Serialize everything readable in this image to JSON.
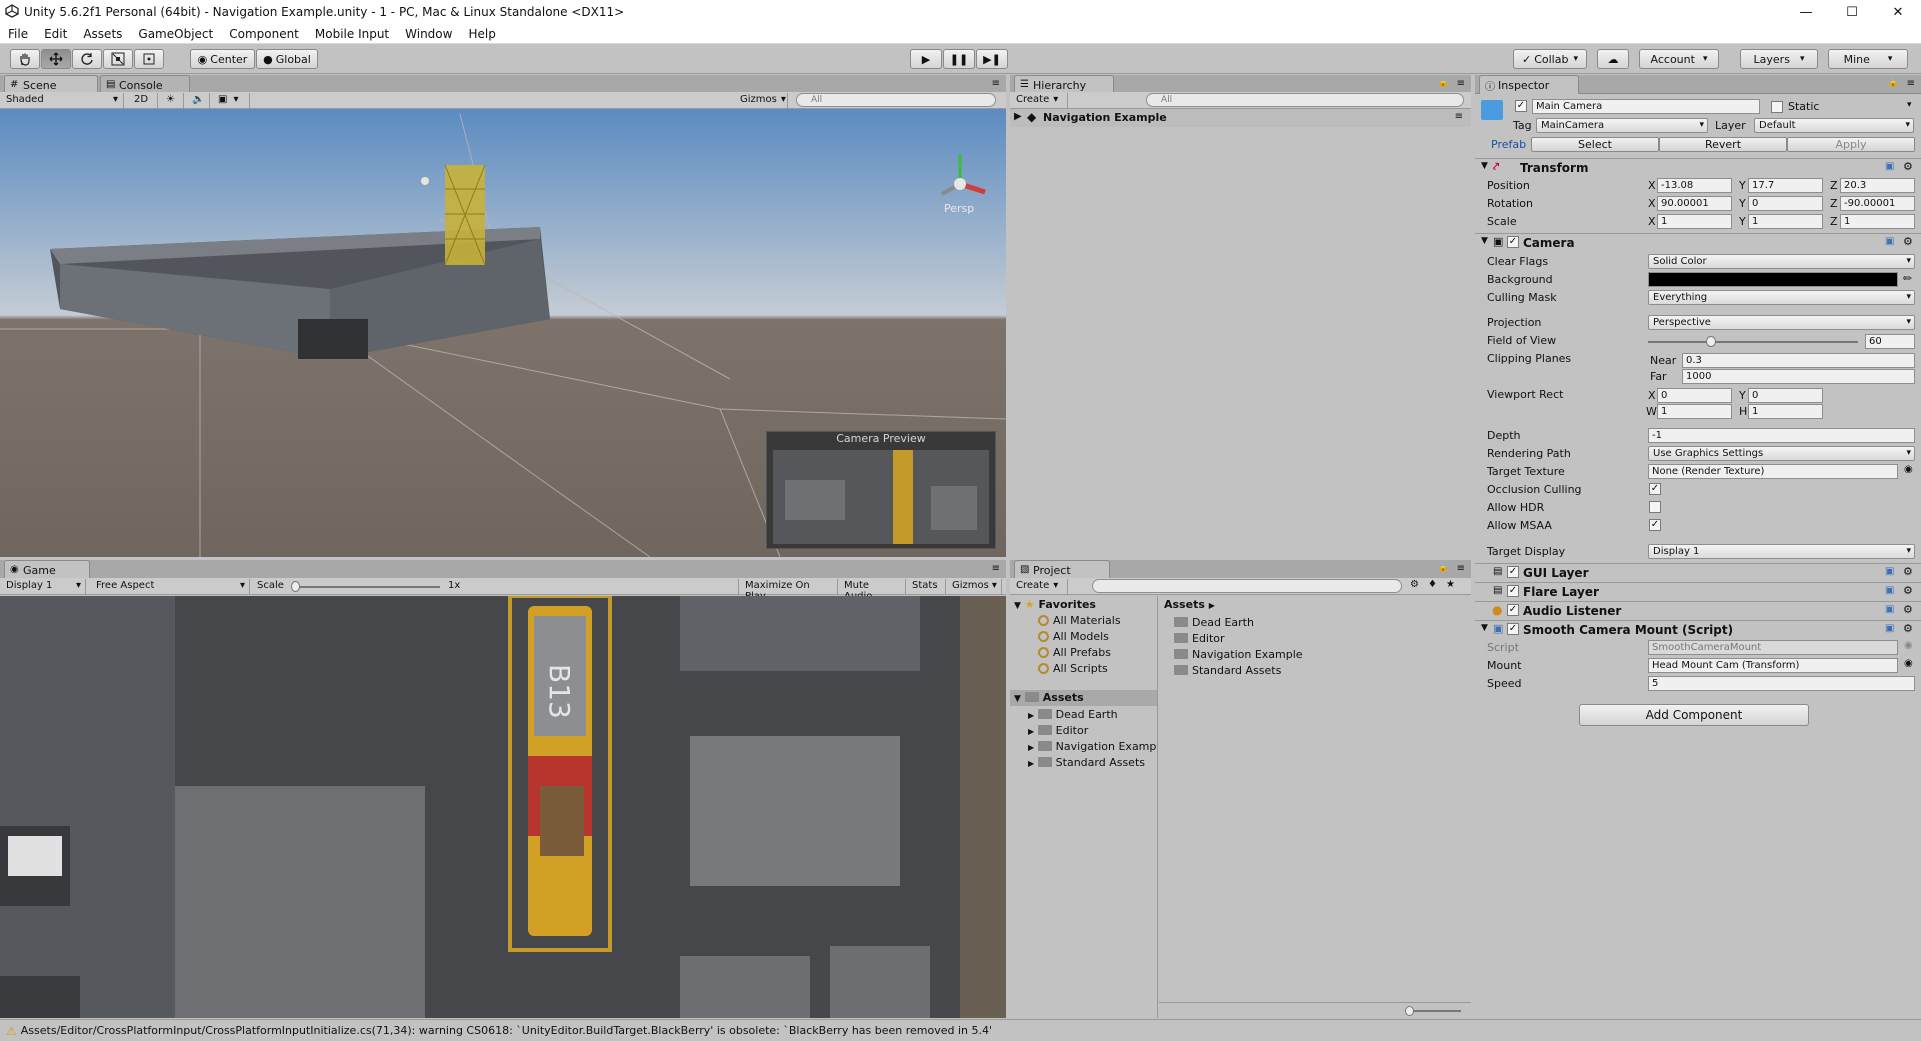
{
  "window": {
    "title": "Unity 5.6.2f1 Personal (64bit) - Navigation Example.unity - 1 - PC, Mac & Linux Standalone <DX11>",
    "min": "—",
    "max": "☐",
    "close": "✕"
  },
  "menu": [
    "File",
    "Edit",
    "Assets",
    "GameObject",
    "Component",
    "Mobile Input",
    "Window",
    "Help"
  ],
  "toolbar": {
    "center": "Center",
    "global": "Global",
    "collab": "Collab",
    "account": "Account",
    "layers": "Layers",
    "layout": "Mine"
  },
  "scene": {
    "tab": "Scene",
    "console_tab": "Console",
    "shading": "Shaded",
    "mode2d": "2D",
    "gizmos": "Gizmos",
    "search": "All",
    "persp": "Persp",
    "camera_preview": "Camera Preview"
  },
  "game": {
    "tab": "Game",
    "display": "Display 1",
    "aspect": "Free Aspect",
    "scale_label": "Scale",
    "scale_value": "1x",
    "maximize": "Maximize On Play",
    "mute": "Mute Audio",
    "stats": "Stats",
    "gizmos": "Gizmos",
    "tram_number": "B13"
  },
  "hierarchy": {
    "tab": "Hierarchy",
    "create": "Create",
    "search": "All",
    "root": "Navigation Example"
  },
  "project": {
    "tab": "Project",
    "create": "Create",
    "favorites": "Favorites",
    "fav_items": [
      "All Materials",
      "All Models",
      "All Prefabs",
      "All Scripts"
    ],
    "assets": "Assets",
    "asset_tree": [
      "Dead Earth",
      "Editor",
      "Navigation Examp",
      "Standard Assets"
    ],
    "breadcrumb": "Assets",
    "asset_items": [
      "Dead Earth",
      "Editor",
      "Navigation Example",
      "Standard Assets"
    ]
  },
  "inspector": {
    "tab": "Inspector",
    "object_name": "Main Camera",
    "static": "Static",
    "tag_label": "Tag",
    "tag": "MainCamera",
    "layer_label": "Layer",
    "layer": "Default",
    "prefab_label": "Prefab",
    "select": "Select",
    "revert": "Revert",
    "apply": "Apply",
    "transform": {
      "title": "Transform",
      "position": "Position",
      "rotation": "Rotation",
      "scale": "Scale",
      "px": "-13.08",
      "py": "17.7",
      "pz": "20.3",
      "rx": "90.00001",
      "ry": "0",
      "rz": "-90.00001",
      "sx": "1",
      "sy": "1",
      "sz": "1"
    },
    "camera": {
      "title": "Camera",
      "clear_flags_label": "Clear Flags",
      "clear_flags": "Solid Color",
      "background_label": "Background",
      "culling_label": "Culling Mask",
      "culling": "Everything",
      "projection_label": "Projection",
      "projection": "Perspective",
      "fov_label": "Field of View",
      "fov": "60",
      "fov_fraction": 0.3,
      "clipping_label": "Clipping Planes",
      "near_label": "Near",
      "near": "0.3",
      "far_label": "Far",
      "far": "1000",
      "viewport_label": "Viewport Rect",
      "vx": "0",
      "vy": "0",
      "vw": "1",
      "vh": "1",
      "depth_label": "Depth",
      "depth": "-1",
      "rendering_label": "Rendering Path",
      "rendering": "Use Graphics Settings",
      "target_tex_label": "Target Texture",
      "target_tex": "None (Render Texture)",
      "occlusion_label": "Occlusion Culling",
      "occlusion": true,
      "hdr_label": "Allow HDR",
      "hdr": false,
      "msaa_label": "Allow MSAA",
      "msaa": true,
      "target_display_label": "Target Display",
      "target_display": "Display 1"
    },
    "gui_layer": "GUI Layer",
    "flare_layer": "Flare Layer",
    "audio_listener": "Audio Listener",
    "smooth": {
      "title": "Smooth Camera Mount (Script)",
      "script_label": "Script",
      "script": "SmoothCameraMount",
      "mount_label": "Mount",
      "mount": "Head Mount Cam (Transform)",
      "speed_label": "Speed",
      "speed": "5"
    },
    "add_component": "Add Component"
  },
  "status": "Assets/Editor/CrossPlatformInput/CrossPlatformInputInitialize.cs(71,34): warning CS0618: `UnityEditor.BuildTarget.BlackBerry' is obsolete: `BlackBerry has been removed in 5.4'",
  "colors": {
    "sky": "#5b8bc1",
    "ground": "#716860",
    "panel": "#c2c2c2",
    "selection": "#3d7bd6"
  }
}
